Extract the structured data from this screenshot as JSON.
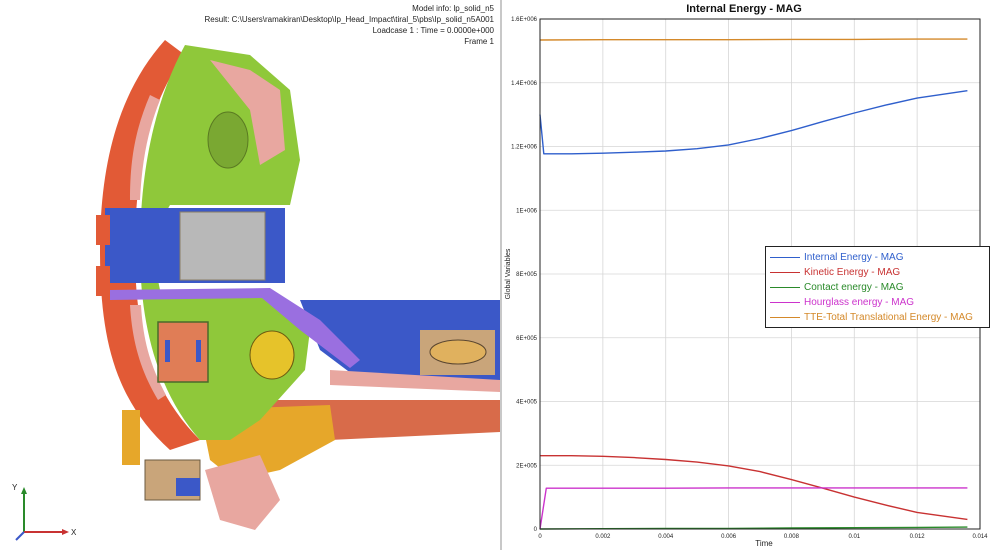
{
  "viewport": {
    "info": {
      "model_info": "Model info: lp_solid_n5",
      "result": "Result: C:\\Users\\ramakiran\\Desktop\\Ip_Head_Impact\\tiral_5\\pbs\\Ip_solid_n5A001",
      "loadcase": "Loadcase 1 : Time = 0.0000e+000",
      "frame": "Frame 1"
    },
    "triad": {
      "y_label": "Y",
      "x_label": "X"
    }
  },
  "chart_data": {
    "type": "line",
    "title": "Internal Energy - MAG",
    "xlabel": "Time",
    "ylabel": "Global Variables",
    "xlim": [
      0,
      0.014
    ],
    "ylim": [
      0,
      1600000
    ],
    "x_ticks": [
      "0",
      "0.002",
      "0.004",
      "0.006",
      "0.008",
      "0.01",
      "0.012",
      "0.014"
    ],
    "y_ticks": [
      "0",
      "2E+005",
      "4E+005",
      "6E+005",
      "8E+005",
      "1E+006",
      "1.2E+006",
      "1.4E+006",
      "1.6E+006"
    ],
    "grid": true,
    "legend_position": "right",
    "series": [
      {
        "name": "Internal Energy - MAG",
        "color": "#2f5fcc",
        "x": [
          0,
          0.00012,
          0.001,
          0.002,
          0.003,
          0.004,
          0.005,
          0.006,
          0.007,
          0.008,
          0.009,
          0.01,
          0.011,
          0.012,
          0.0136
        ],
        "y": [
          1300000,
          1177000,
          1177000,
          1179000,
          1182000,
          1186000,
          1193000,
          1205000,
          1225000,
          1250000,
          1278000,
          1305000,
          1330000,
          1352000,
          1375000
        ]
      },
      {
        "name": "Kinetic Energy - MAG",
        "color": "#c83232",
        "x": [
          0,
          0.001,
          0.002,
          0.003,
          0.004,
          0.005,
          0.006,
          0.007,
          0.008,
          0.009,
          0.01,
          0.011,
          0.012,
          0.0136
        ],
        "y": [
          230000,
          230000,
          228000,
          224000,
          218000,
          210000,
          198000,
          180000,
          155000,
          128000,
          100000,
          75000,
          52000,
          30000
        ]
      },
      {
        "name": "Contact energy - MAG",
        "color": "#2a8a2a",
        "x": [
          0,
          0.002,
          0.004,
          0.006,
          0.008,
          0.01,
          0.012,
          0.0136
        ],
        "y": [
          0,
          1000,
          1500,
          2000,
          3000,
          4000,
          5000,
          6000
        ]
      },
      {
        "name": "Hourglass energy - MAG",
        "color": "#cc33cc",
        "x": [
          0,
          0.0002,
          0.002,
          0.004,
          0.006,
          0.008,
          0.01,
          0.012,
          0.0136
        ],
        "y": [
          0,
          128000,
          128000,
          128000,
          129000,
          129000,
          129000,
          129000,
          129000
        ]
      },
      {
        "name": "TTE-Total Translational Energy - MAG",
        "color": "#d4892a",
        "x": [
          0,
          0.002,
          0.004,
          0.006,
          0.008,
          0.01,
          0.012,
          0.0136
        ],
        "y": [
          1534000,
          1535000,
          1535000,
          1535000,
          1536000,
          1536000,
          1537000,
          1537000
        ]
      }
    ]
  }
}
